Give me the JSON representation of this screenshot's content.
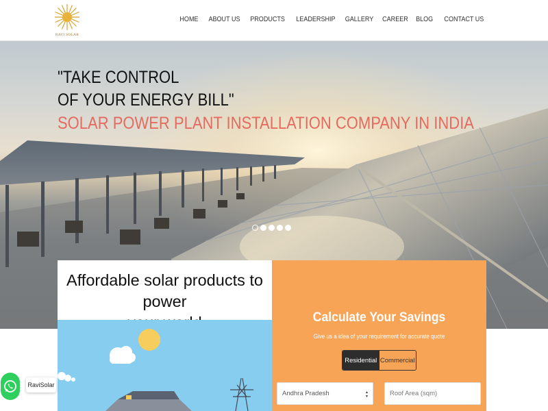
{
  "brand": {
    "logo_text": "RAVI SOLAR",
    "logo_color": "#d9a22c"
  },
  "nav": {
    "items": [
      {
        "label": "HOME"
      },
      {
        "label": "ABOUT US"
      },
      {
        "label": "PRODUCTS"
      },
      {
        "label": "LEADERSHIP"
      },
      {
        "label": "GALLERY"
      },
      {
        "label": "CAREER"
      },
      {
        "label": "BLOG"
      },
      {
        "label": "CONTACT US"
      }
    ]
  },
  "hero": {
    "title_line1": "\"TAKE CONTROL",
    "title_line2": "OF YOUR ENERGY BILL\"",
    "subtitle": "SOLAR POWER PLANT INSTALLATION COMPANY IN INDIA",
    "slides_total": 5,
    "active_slide": 1
  },
  "products_card": {
    "heading_line1": "Affordable solar products to power",
    "heading_line2": "your world"
  },
  "calculator": {
    "title": "Calculate Your Savings",
    "subtitle": "Give us a idea of your requirement for accurate quote",
    "tabs": [
      {
        "label": "Residential",
        "active": true
      },
      {
        "label": "Commercial",
        "active": false
      }
    ],
    "state_select": {
      "value": "Andhra Pradesh"
    },
    "roof_area": {
      "placeholder": "Roof Area (sqm)"
    }
  },
  "whatsapp": {
    "label": "RaviSolar"
  },
  "colors": {
    "accent_orange": "#f8a457",
    "subtitle_red": "#e46b60",
    "whatsapp_green": "#2fcf5d",
    "sky_blue": "#86cdf0"
  }
}
